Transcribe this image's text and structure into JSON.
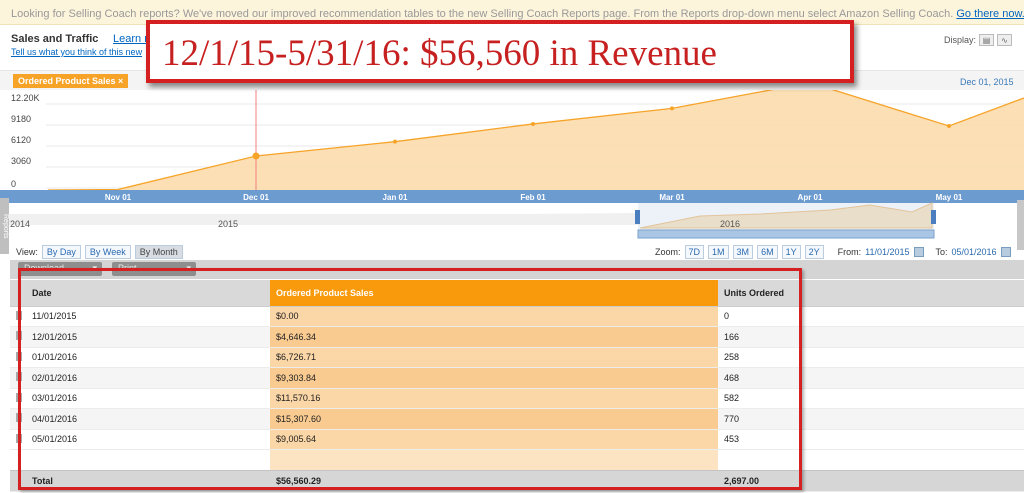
{
  "banner": {
    "text": "Looking for Selling Coach reports? We've moved our improved recommendation tables to the new Selling Coach Reports page. From the Reports drop-down menu select Amazon Selling Coach.",
    "link": "Go there now."
  },
  "header": {
    "title": "Sales and Traffic",
    "learn_more": "Learn m",
    "feedback": "Tell us what you think of this new"
  },
  "display": {
    "label": "Display:",
    "table_icon": "table-icon",
    "chart_icon": "line-chart-icon"
  },
  "callout": {
    "text": "12/1/15-5/31/16: $56,560 in Revenue"
  },
  "chart": {
    "legend_label": "Ordered Product Sales ×",
    "hover_date": "Dec 01, 2015",
    "accent_color": "#f6a328",
    "y_ticks": [
      "12.20K",
      "9180",
      "6120",
      "3060",
      "0"
    ],
    "x_ticks": [
      "Nov 01",
      "Dec 01",
      "Jan 01",
      "Feb 01",
      "Mar 01",
      "Apr 01",
      "May 01"
    ],
    "navigator_years": [
      "2014",
      "2015",
      "2016"
    ]
  },
  "chart_data": {
    "type": "area",
    "title": "",
    "xlabel": "",
    "ylabel": "",
    "categories": [
      "Nov 01",
      "Dec 01",
      "Jan 01",
      "Feb 01",
      "Mar 01",
      "Apr 01",
      "May 01"
    ],
    "series": [
      {
        "values": [
          0,
          4646.34,
          6726.71,
          9303.84,
          11570.16,
          15307.6,
          9005.64
        ]
      }
    ],
    "ylim": [
      0,
      12200
    ],
    "grid": true
  },
  "controls": {
    "view_label": "View:",
    "view_buttons": [
      "By Day",
      "By Week",
      "By Month"
    ],
    "zoom_label": "Zoom:",
    "zoom_buttons": [
      "7D",
      "1M",
      "3M",
      "6M",
      "1Y",
      "2Y"
    ],
    "from_label": "From:",
    "from_value": "11/01/2015",
    "to_label": "To:",
    "to_value": "05/01/2016"
  },
  "toolbar": {
    "download_label": "Download",
    "print_label": "Print"
  },
  "table": {
    "columns": [
      "Date",
      "Ordered Product Sales",
      "Units Ordered"
    ],
    "rows": [
      [
        "11/01/2015",
        "$0.00",
        "0"
      ],
      [
        "12/01/2015",
        "$4,646.34",
        "166"
      ],
      [
        "01/01/2016",
        "$6,726.71",
        "258"
      ],
      [
        "02/01/2016",
        "$9,303.84",
        "468"
      ],
      [
        "03/01/2016",
        "$11,570.16",
        "582"
      ],
      [
        "04/01/2016",
        "$15,307.60",
        "770"
      ],
      [
        "05/01/2016",
        "$9,005.64",
        "453"
      ]
    ],
    "total": [
      "Total",
      "$56,560.29",
      "2,697.00"
    ]
  }
}
